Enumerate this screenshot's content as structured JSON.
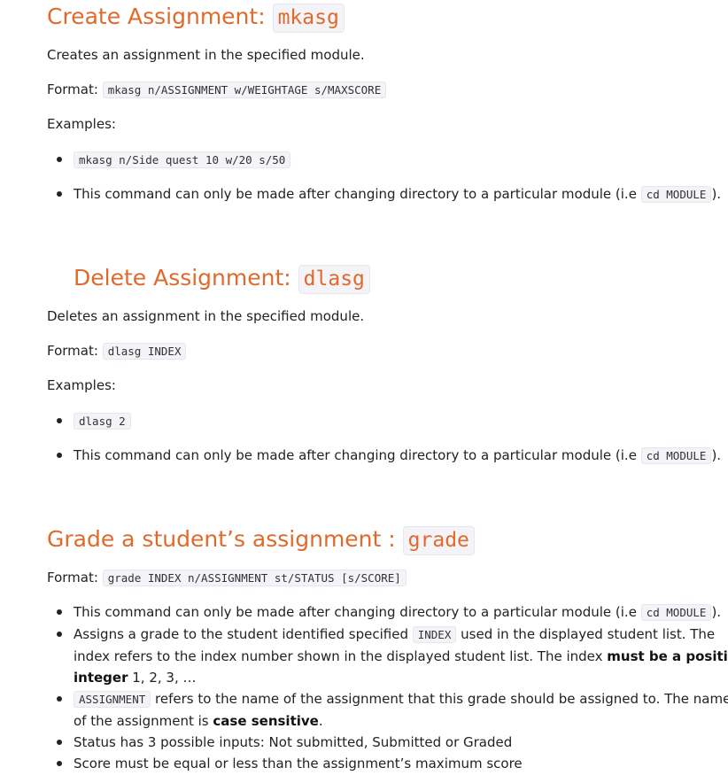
{
  "create": {
    "title": "Create Assignment: ",
    "command": "mkasg",
    "description": "Creates an assignment in the specified module.",
    "format_label": "Format: ",
    "format_code": "mkasg n/ASSIGNMENT w/WEIGHTAGE s/MAXSCORE",
    "examples_label": "Examples:",
    "example_code": "mkasg n/Side quest 10 w/20 s/50",
    "note_prefix": "This command can only be made after changing directory to a particular module (i.e ",
    "note_code": "cd MODULE",
    "note_suffix": ")."
  },
  "delete": {
    "title": "Delete Assignment: ",
    "command": "dlasg",
    "description": "Deletes an assignment in the specified module.",
    "format_label": "Format: ",
    "format_code": "dlasg INDEX",
    "examples_label": "Examples:",
    "example_code": "dlasg 2",
    "note_prefix": "This command can only be made after changing directory to a particular module (i.e ",
    "note_code": "cd MODULE",
    "note_suffix": ")."
  },
  "grade": {
    "title": "Grade a student’s assignment : ",
    "command": "grade",
    "format_label": "Format: ",
    "format_code": "grade INDEX n/ASSIGNMENT st/STATUS [s/SCORE]",
    "note_prefix": "This command can only be made after changing directory to a particular module (i.e ",
    "note_code": "cd MODULE",
    "note_suffix": ").",
    "assign_prefix": "Assigns a grade to the student identified specified ",
    "assign_code": "INDEX",
    "assign_suffix": " used in the displayed student list. The",
    "assign_line2": "index refers to the index number shown in the displayed student list. The index ",
    "assign_bold1": "must be a positive",
    "assign_bold2": "integer",
    "assign_line3_suffix": " 1, 2, 3, …",
    "assignment_code": "ASSIGNMENT",
    "assignment_suffix": " refers to the name of the assignment that this grade should be assigned to. The name",
    "assignment_line2": "of the assignment is ",
    "assignment_bold": "case sensitive",
    "assignment_end": ".",
    "status_note": "Status has 3 possible inputs: Not submitted, Submitted or Graded",
    "score_note": "Score must be equal or less than the assignment’s maximum score"
  },
  "colors": {
    "heading": "#e06a2b",
    "code_bg": "#f3f3f8",
    "text": "#222222"
  }
}
